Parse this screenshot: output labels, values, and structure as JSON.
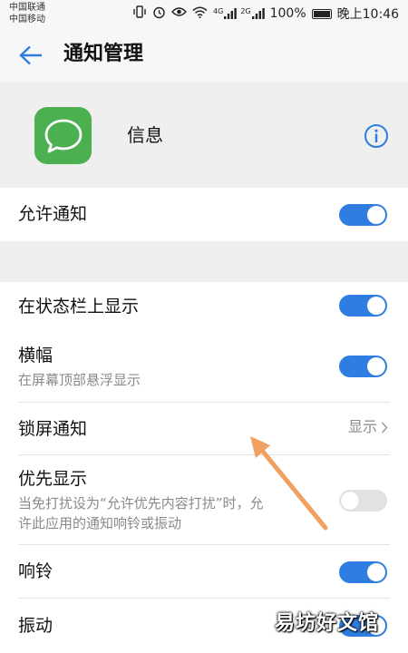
{
  "status_bar": {
    "carrier_1": "中国联通",
    "carrier_2": "中国移动",
    "signal_1_label": "4G",
    "signal_2_label": "2G",
    "battery": "100%",
    "time": "晚上10:46",
    "icons": [
      "vibrate-icon",
      "alarm-icon",
      "eye-icon",
      "wifi-icon",
      "signal-icon",
      "battery-icon"
    ]
  },
  "app_bar": {
    "title": "通知管理",
    "back_icon": "arrow-left-icon"
  },
  "app_header": {
    "app_name": "信息",
    "app_icon": "message-bubble-icon",
    "info_icon": "info-circle-icon"
  },
  "settings": {
    "allow_notifications": {
      "label": "允许通知",
      "enabled": true
    },
    "status_bar_display": {
      "label": "在状态栏上显示",
      "enabled": true
    },
    "banner": {
      "label": "横幅",
      "sublabel": "在屏幕顶部悬浮显示",
      "enabled": true
    },
    "lockscreen": {
      "label": "锁屏通知",
      "value": "显示"
    },
    "priority": {
      "label": "优先显示",
      "sublabel_1": "当免打扰设为“允许优先内容打扰”时，允",
      "sublabel_2": "许此应用的通知响铃或振动",
      "enabled": false
    },
    "ringtone": {
      "label": "响铃",
      "enabled": true
    },
    "vibration": {
      "label": "振动",
      "enabled": true
    }
  },
  "watermark": "易坊好文馆",
  "colors": {
    "accent": "#2f7de1",
    "app_icon_bg": "#4caf50",
    "annotation_arrow": "#f0a060"
  }
}
